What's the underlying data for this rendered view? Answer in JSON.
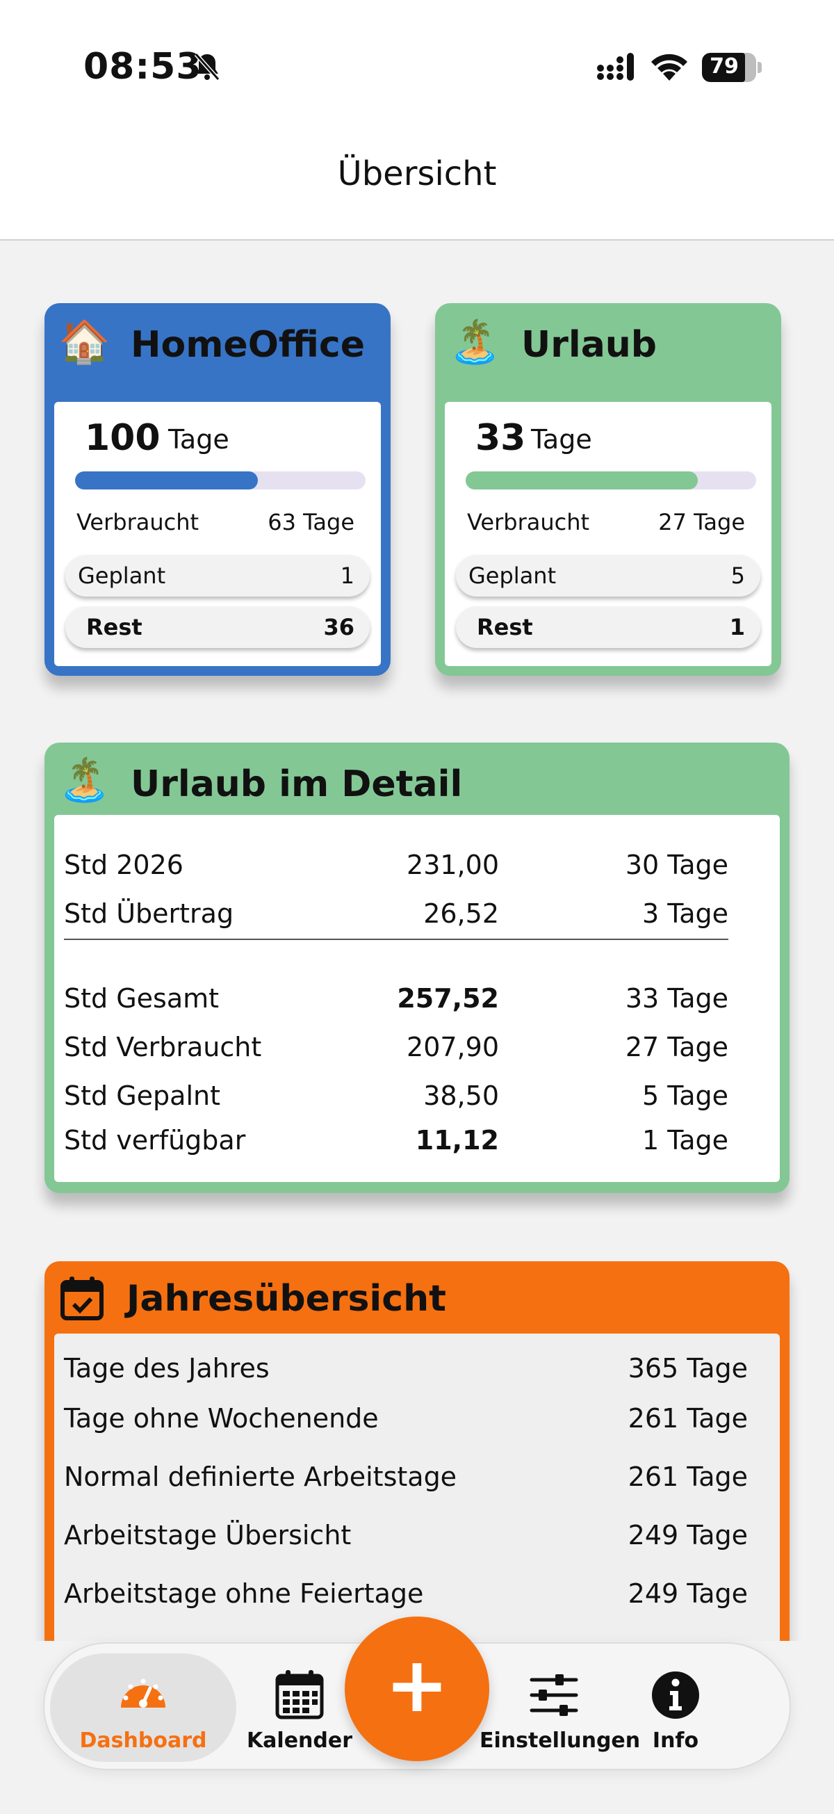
{
  "status_bar": {
    "time": "08:53",
    "battery": "79",
    "battery_level": 0.79
  },
  "header": {
    "title": "Übersicht"
  },
  "colors": {
    "homeoffice": "#3774c6",
    "urlaub": "#83c795",
    "jahr": "#f57011",
    "accent": "#f57011",
    "track": "#e6e1f0"
  },
  "cards": {
    "homeoffice": {
      "emoji": "🏠",
      "title": "HomeOffice",
      "total": "100",
      "unit": "Tage",
      "progress": 0.63,
      "verbraucht_label": "Verbraucht",
      "verbraucht_value": "63 Tage",
      "geplant_label": "Geplant",
      "geplant_value": "1",
      "rest_label": "Rest",
      "rest_value": "36"
    },
    "urlaub": {
      "emoji": "🏝️",
      "title": "Urlaub",
      "total": "33",
      "unit": "Tage",
      "progress": 0.8,
      "verbraucht_label": "Verbraucht",
      "verbraucht_value": "27 Tage",
      "geplant_label": "Geplant",
      "geplant_value": "5",
      "rest_label": "Rest",
      "rest_value": "1"
    }
  },
  "detail": {
    "emoji": "🏝️",
    "title": "Urlaub im Detail",
    "rows": [
      {
        "label": "Std  2026",
        "std": "231,00",
        "days": "30 Tage"
      },
      {
        "label": "Std Übertrag",
        "std": "26,52",
        "days": "3 Tage"
      },
      {
        "label": "Std Gesamt",
        "std": "257,52",
        "days": "33 Tage"
      },
      {
        "label": "Std Verbraucht",
        "std": "207,90",
        "days": "27 Tage"
      },
      {
        "label": "Std Gepalnt",
        "std": "38,50",
        "days": "5 Tage"
      },
      {
        "label": "Std verfügbar",
        "std": "11,12",
        "days": "1 Tage"
      }
    ]
  },
  "year": {
    "title": "Jahresübersicht",
    "rows": [
      {
        "label": "Tage des Jahres",
        "value": "365 Tage"
      },
      {
        "label": "Tage ohne Wochenende",
        "value": "261 Tage"
      },
      {
        "label": "Normal definierte Arbeitstage",
        "value": "261 Tage"
      },
      {
        "label": "Arbeitstage Übersicht",
        "value": "249 Tage"
      },
      {
        "label": "Arbeitstage ohne Feiertage",
        "value": "249 Tage"
      }
    ]
  },
  "tabs": {
    "dashboard": "Dashboard",
    "kalender": "Kalender",
    "einstellungen": "Einstellungen",
    "info": "Info",
    "add": "+"
  }
}
